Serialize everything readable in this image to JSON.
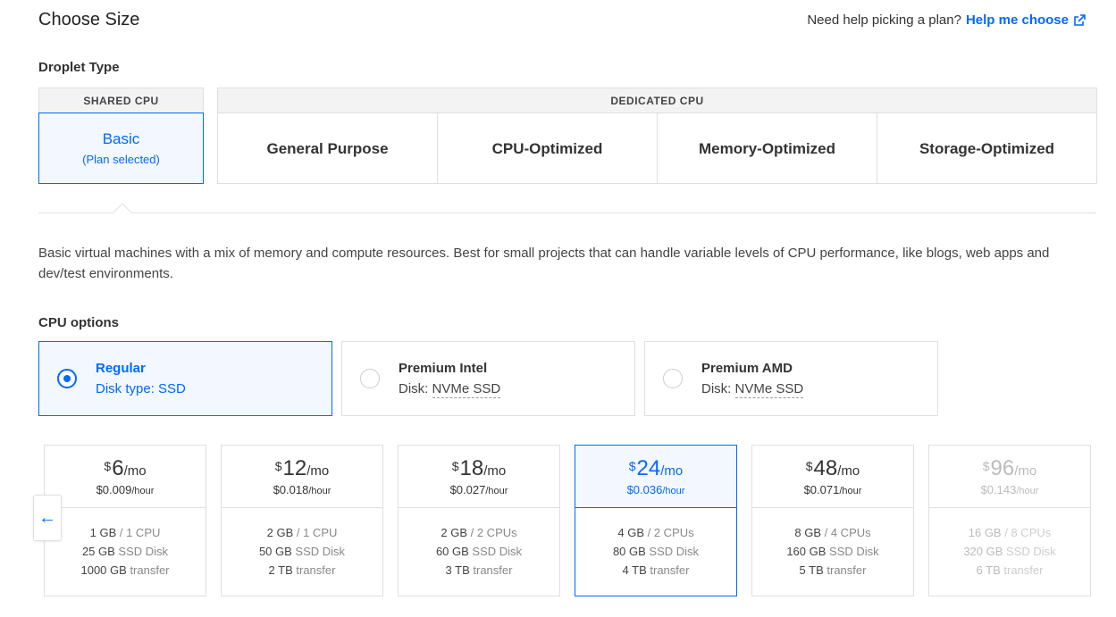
{
  "header": {
    "title": "Choose Size",
    "help_text": "Need help picking a plan?",
    "help_link": "Help me choose"
  },
  "droplet_type": {
    "label": "Droplet Type",
    "shared": {
      "group_label": "SHARED CPU",
      "option": "Basic",
      "option_sub": "(Plan selected)"
    },
    "dedicated": {
      "group_label": "DEDICATED CPU",
      "options": [
        "General Purpose",
        "CPU-Optimized",
        "Memory-Optimized",
        "Storage-Optimized"
      ]
    }
  },
  "description": "Basic virtual machines with a mix of memory and compute resources. Best for small projects that can handle variable levels of CPU performance, like blogs, web apps and dev/test environments.",
  "cpu_options": {
    "label": "CPU options",
    "items": [
      {
        "name": "Regular",
        "disk_label": "Disk type:",
        "disk_value": "SSD",
        "selected": true
      },
      {
        "name": "Premium Intel",
        "disk_label": "Disk:",
        "disk_value": "NVMe SSD",
        "selected": false
      },
      {
        "name": "Premium AMD",
        "disk_label": "Disk:",
        "disk_value": "NVMe SSD",
        "selected": false
      }
    ]
  },
  "plans": [
    {
      "currency": "$",
      "amount": "6",
      "per": "/mo",
      "hourly": "$0.009",
      "hour_unit": "/hour",
      "ram": "1 GB",
      "cpu": "/ 1 CPU",
      "disk": "25 GB",
      "disk_type": "SSD Disk",
      "transfer": "1000 GB",
      "transfer_label": "transfer"
    },
    {
      "currency": "$",
      "amount": "12",
      "per": "/mo",
      "hourly": "$0.018",
      "hour_unit": "/hour",
      "ram": "2 GB",
      "cpu": "/ 1 CPU",
      "disk": "50 GB",
      "disk_type": "SSD Disk",
      "transfer": "2 TB",
      "transfer_label": "transfer"
    },
    {
      "currency": "$",
      "amount": "18",
      "per": "/mo",
      "hourly": "$0.027",
      "hour_unit": "/hour",
      "ram": "2 GB",
      "cpu": "/ 2 CPUs",
      "disk": "60 GB",
      "disk_type": "SSD Disk",
      "transfer": "3 TB",
      "transfer_label": "transfer"
    },
    {
      "currency": "$",
      "amount": "24",
      "per": "/mo",
      "hourly": "$0.036",
      "hour_unit": "/hour",
      "ram": "4 GB",
      "cpu": "/ 2 CPUs",
      "disk": "80 GB",
      "disk_type": "SSD Disk",
      "transfer": "4 TB",
      "transfer_label": "transfer"
    },
    {
      "currency": "$",
      "amount": "48",
      "per": "/mo",
      "hourly": "$0.071",
      "hour_unit": "/hour",
      "ram": "8 GB",
      "cpu": "/ 4 CPUs",
      "disk": "160 GB",
      "disk_type": "SSD Disk",
      "transfer": "5 TB",
      "transfer_label": "transfer"
    },
    {
      "currency": "$",
      "amount": "96",
      "per": "/mo",
      "hourly": "$0.143",
      "hour_unit": "/hour",
      "ram": "16 GB",
      "cpu": "/ 8 CPUs",
      "disk": "320 GB",
      "disk_type": "SSD Disk",
      "transfer": "6 TB",
      "transfer_label": "transfer"
    }
  ],
  "scroll_arrow": "←",
  "colors": {
    "accent": "#0069ff",
    "border": "#dfdfdf",
    "selected_bg": "#f3f7ff"
  }
}
